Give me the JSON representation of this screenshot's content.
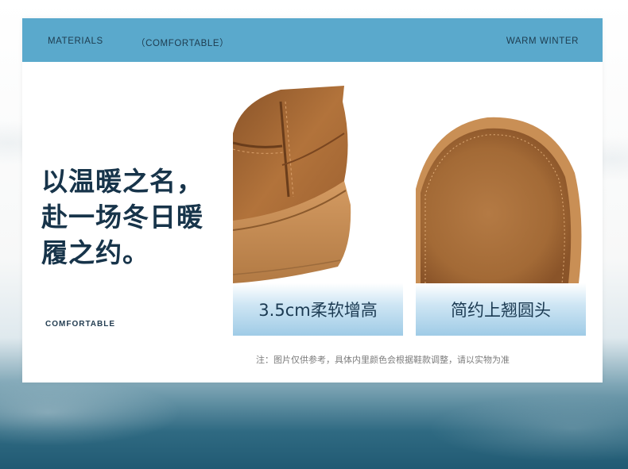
{
  "header": {
    "left_label": "MATERIALS",
    "middle_label": "（COMFORTABLE）",
    "right_label": "WARM WINTER"
  },
  "headline": {
    "lines": [
      "以温暖之名，",
      "赴一场冬日暖",
      "履之约。"
    ]
  },
  "side_label": "COMFORTABLE",
  "features": [
    {
      "caption": "3.5cm柔软增高"
    },
    {
      "caption": "简约上翘圆头"
    }
  ],
  "note": "注：图片仅供参考，具体内里颜色会根据鞋款调整，请以实物为准",
  "colors": {
    "header_blue": "#5aa9cc",
    "text_navy": "#17344a",
    "suede_brown": "#a86a35",
    "sole_tan": "#c48b52"
  }
}
